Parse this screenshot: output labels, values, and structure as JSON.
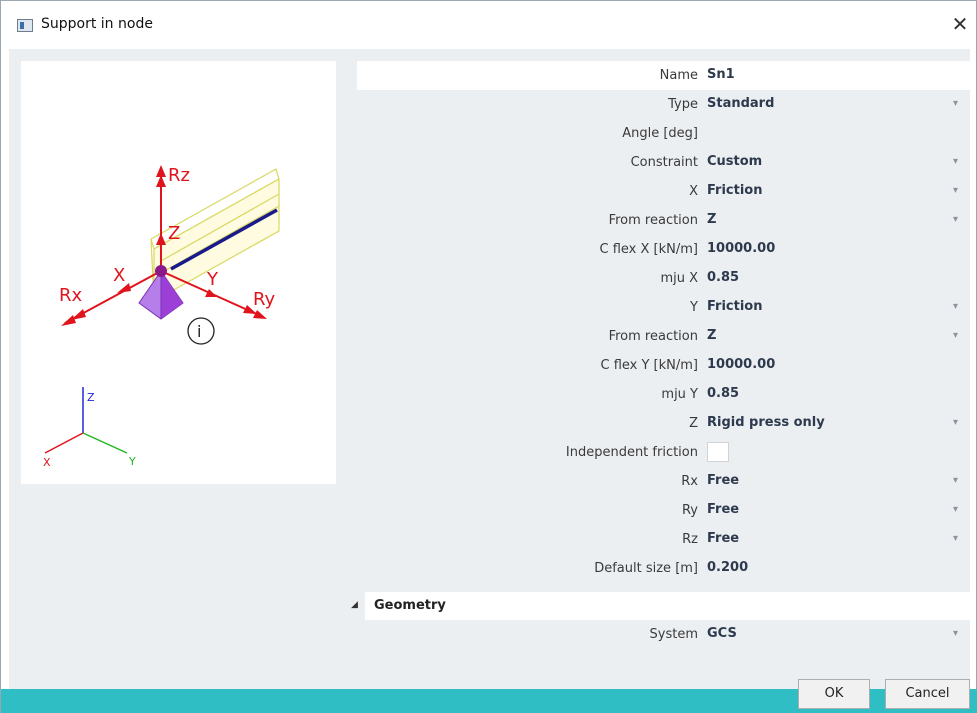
{
  "window": {
    "title": "Support in node"
  },
  "preview": {
    "labels": {
      "rz": "Rz",
      "z": "Z",
      "x": "X",
      "y": "Y",
      "rx": "Rx",
      "ry": "Ry",
      "info": "i"
    },
    "axes": {
      "x": "X",
      "y": "Y",
      "z": "Z"
    }
  },
  "properties": [
    {
      "label": "Name",
      "value": "Sn1",
      "dropdown": false
    },
    {
      "label": "Type",
      "value": "Standard",
      "dropdown": true
    },
    {
      "label": "Angle [deg]",
      "value": "",
      "dropdown": false
    },
    {
      "label": "Constraint",
      "value": "Custom",
      "dropdown": true
    },
    {
      "label": "X",
      "value": "Friction",
      "dropdown": true
    },
    {
      "label": "From reaction",
      "value": "Z",
      "dropdown": true
    },
    {
      "label": "C flex X [kN/m]",
      "value": "10000.00",
      "dropdown": false
    },
    {
      "label": "mju X",
      "value": "0.85",
      "dropdown": false
    },
    {
      "label": "Y",
      "value": "Friction",
      "dropdown": true
    },
    {
      "label": "From reaction",
      "value": "Z",
      "dropdown": true
    },
    {
      "label": "C flex Y [kN/m]",
      "value": "10000.00",
      "dropdown": false
    },
    {
      "label": "mju Y",
      "value": "0.85",
      "dropdown": false
    },
    {
      "label": "Z",
      "value": "Rigid press only",
      "dropdown": true
    },
    {
      "label": "Independent friction",
      "value": "",
      "checkbox": true
    },
    {
      "label": "Rx",
      "value": "Free",
      "dropdown": true
    },
    {
      "label": "Ry",
      "value": "Free",
      "dropdown": true
    },
    {
      "label": "Rz",
      "value": "Free",
      "dropdown": true
    },
    {
      "label": "Default size [m]",
      "value": "0.200",
      "dropdown": false
    }
  ],
  "geometry": {
    "title": "Geometry",
    "system_label": "System",
    "system_value": "GCS"
  },
  "buttons": {
    "ok": "OK",
    "cancel": "Cancel"
  },
  "colors": {
    "accent": "#2fbec4",
    "arrow": "#e0141c",
    "support": "#9b3fd6",
    "beam": "#1a1a8c"
  }
}
